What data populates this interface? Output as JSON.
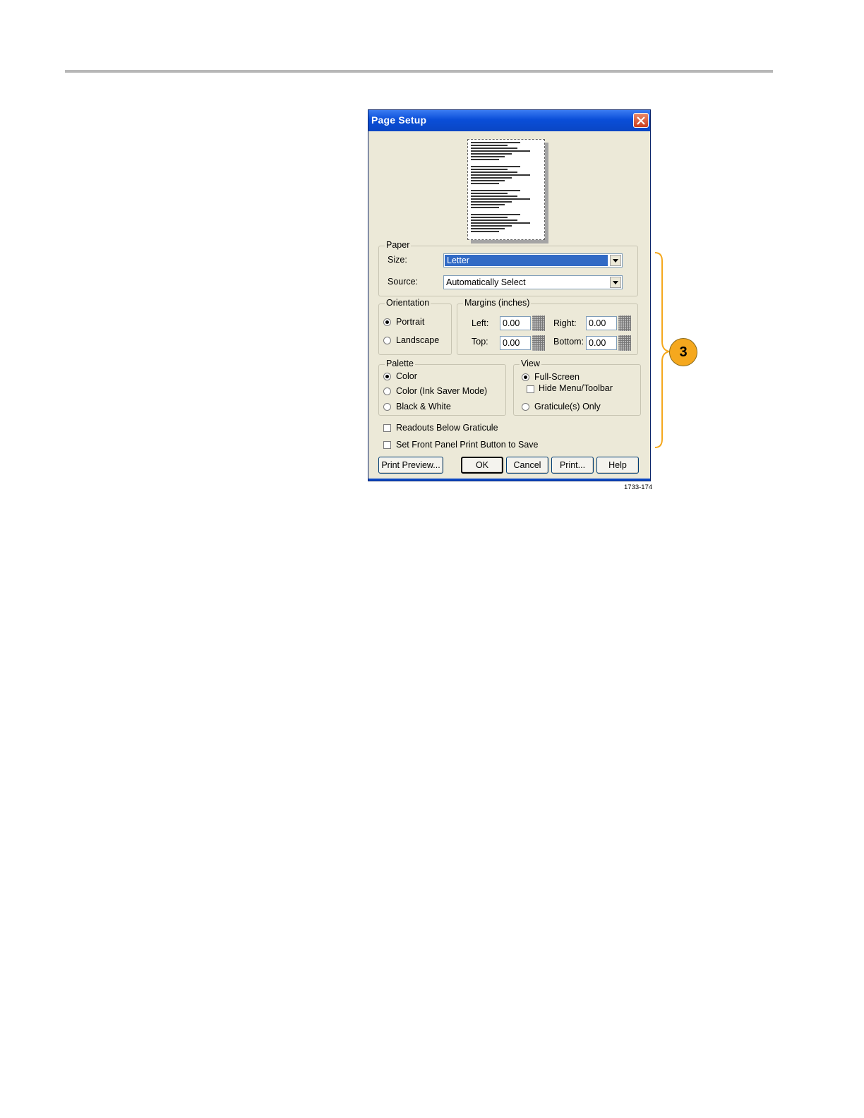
{
  "dialog": {
    "title": "Page Setup",
    "paper": {
      "legend": "Paper",
      "size_label": "Size:",
      "size_value": "Letter",
      "source_label": "Source:",
      "source_value": "Automatically Select"
    },
    "orientation": {
      "legend": "Orientation",
      "options": [
        "Portrait",
        "Landscape"
      ],
      "selected": "Portrait"
    },
    "margins": {
      "legend": "Margins (inches)",
      "left_label": "Left:",
      "left_value": "0.00",
      "right_label": "Right:",
      "right_value": "0.00",
      "top_label": "Top:",
      "top_value": "0.00",
      "bottom_label": "Bottom:",
      "bottom_value": "0.00"
    },
    "palette": {
      "legend": "Palette",
      "options": [
        "Color",
        "Color (Ink Saver Mode)",
        "Black & White"
      ],
      "selected": "Color"
    },
    "view": {
      "legend": "View",
      "full_screen": "Full-Screen",
      "hide_menu": "Hide Menu/Toolbar",
      "graticule_only": "Graticule(s) Only",
      "selected": "Full-Screen"
    },
    "readouts_below": "Readouts Below Graticule",
    "front_panel_save": "Set Front Panel Print Button to Save",
    "buttons": {
      "print_preview": "Print Preview...",
      "ok": "OK",
      "cancel": "Cancel",
      "print": "Print...",
      "help": "Help"
    }
  },
  "callout": {
    "number": "3",
    "color": "#f5a81e"
  },
  "figure_id": "1733-174"
}
